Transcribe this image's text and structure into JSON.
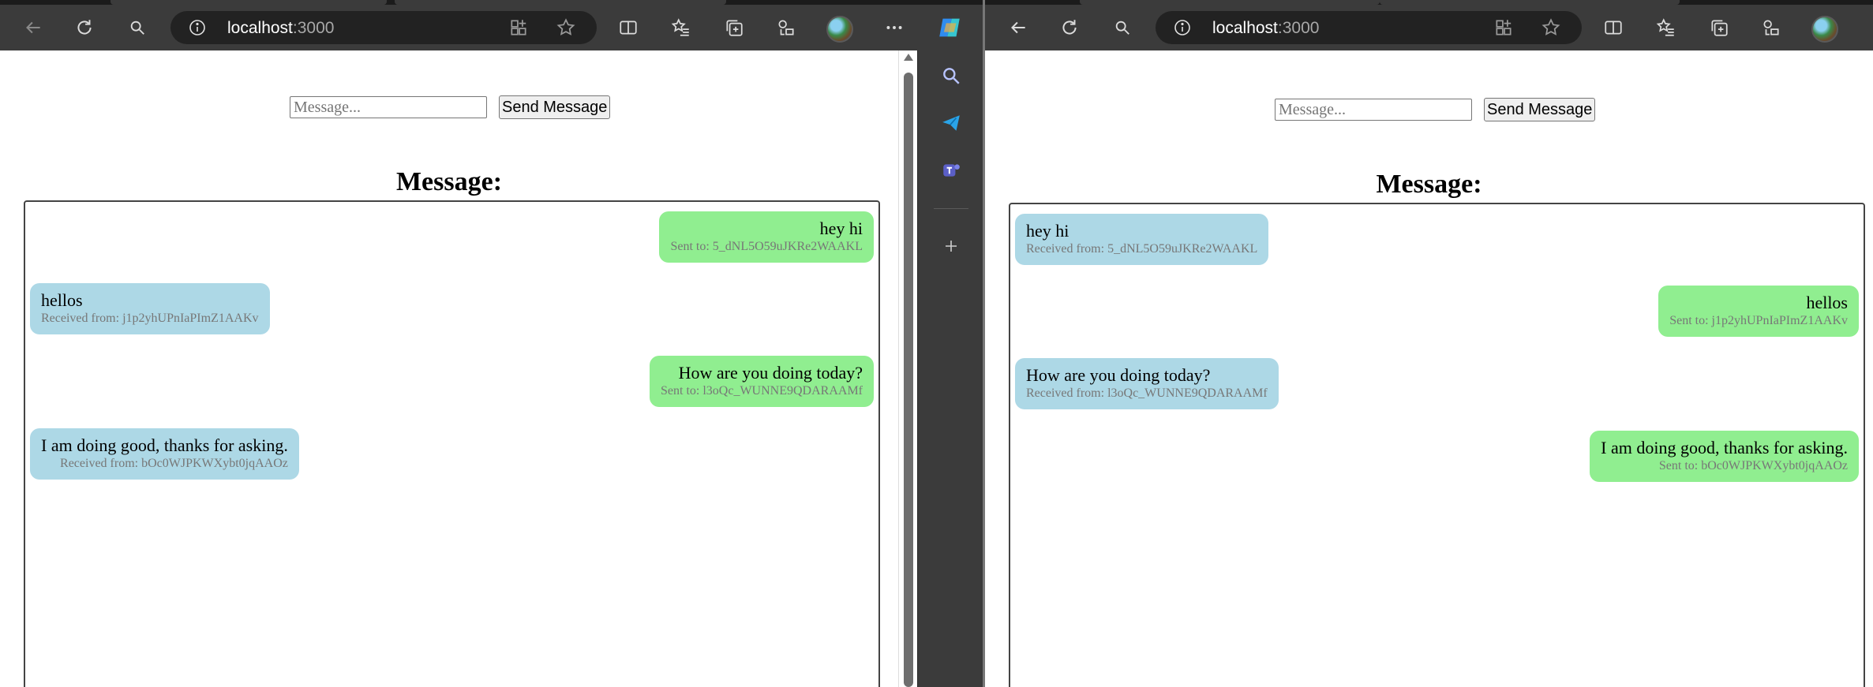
{
  "browser": {
    "url_host": "localhost",
    "url_port": ":3000"
  },
  "page": {
    "message_placeholder": "Message...",
    "send_button_label": "Send Message",
    "heading": "Message:"
  },
  "left": {
    "messages": [
      {
        "kind": "sent",
        "text": "hey hi",
        "meta": "Sent to: 5_dNL5O59uJKRe2WAAKL"
      },
      {
        "kind": "recv",
        "text": "hellos",
        "meta": "Received from: j1p2yhUPnIaPImZ1AAKv"
      },
      {
        "kind": "sent",
        "text": "How are you doing today?",
        "meta": "Sent to: l3oQc_WUNNE9QDARAAMf"
      },
      {
        "kind": "recv",
        "text": "I am doing good, thanks for asking.",
        "meta": "Received from: bOc0WJPKWXybt0jqAAOz"
      }
    ]
  },
  "right": {
    "messages": [
      {
        "kind": "recv",
        "text": "hey hi",
        "meta": "Received from: 5_dNL5O59uJKRe2WAAKL"
      },
      {
        "kind": "sent",
        "text": "hellos",
        "meta": "Sent to: j1p2yhUPnIaPImZ1AAKv"
      },
      {
        "kind": "recv",
        "text": "How are you doing today?",
        "meta": "Received from: l3oQc_WUNNE9QDARAAMf"
      },
      {
        "kind": "sent",
        "text": "I am doing good, thanks for asking.",
        "meta": "Sent to: bOc0WJPKWXybt0jqAAOz"
      }
    ]
  },
  "icons": {
    "back": "back-arrow-icon",
    "refresh": "refresh-icon",
    "search": "search-icon",
    "info": "info-icon",
    "apps": "apps-icon",
    "favorite": "star-icon",
    "split": "split-screen-icon",
    "favorites": "favorites-icon",
    "collections": "collections-icon",
    "extensions": "extensions-icon",
    "more": "more-icon",
    "copilot": "copilot-icon",
    "add": "plus-icon"
  },
  "colors": {
    "sent_bubble": "#90ee90",
    "received_bubble": "#add8e6",
    "toolbar": "#3b3b3b"
  }
}
